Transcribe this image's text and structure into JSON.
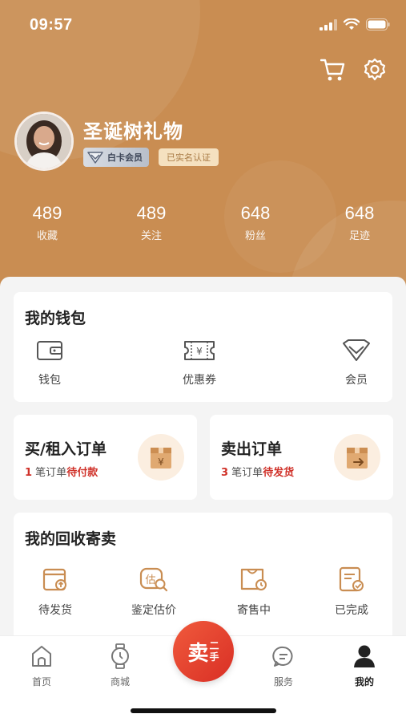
{
  "status_bar": {
    "time": "09:57"
  },
  "profile": {
    "name": "圣诞树礼物",
    "member_badge": "白卡会员",
    "verified_badge": "已实名认证"
  },
  "stats": [
    {
      "value": "489",
      "label": "收藏"
    },
    {
      "value": "489",
      "label": "关注"
    },
    {
      "value": "648",
      "label": "粉丝"
    },
    {
      "value": "648",
      "label": "足迹"
    }
  ],
  "wallet": {
    "title": "我的钱包",
    "items": [
      {
        "label": "钱包",
        "icon": "wallet-icon"
      },
      {
        "label": "优惠券",
        "icon": "coupon-icon"
      },
      {
        "label": "会员",
        "icon": "diamond-icon"
      }
    ]
  },
  "orders": {
    "buy": {
      "title": "买/租入订单",
      "count": "1",
      "text1": " 笔订单",
      "status": "待付款"
    },
    "sell": {
      "title": "卖出订单",
      "count": "3",
      "text1": " 笔订单",
      "status": "待发货"
    }
  },
  "recycle": {
    "title": "我的回收寄卖",
    "items": [
      {
        "label": "待发货",
        "icon": "box-upload-icon"
      },
      {
        "label": "鉴定估价",
        "icon": "appraisal-icon"
      },
      {
        "label": "寄售中",
        "icon": "bag-clock-icon"
      },
      {
        "label": "已完成",
        "icon": "document-check-icon"
      }
    ]
  },
  "tabbar": {
    "items": [
      {
        "label": "首页",
        "icon": "home-icon"
      },
      {
        "label": "商城",
        "icon": "watch-icon"
      },
      {
        "label": "服务",
        "icon": "chat-icon"
      },
      {
        "label": "我的",
        "icon": "user-icon"
      }
    ],
    "sell_main": "卖",
    "sell_sub1": "二",
    "sell_sub2": "手"
  },
  "colors": {
    "header_bg": "#c98d52",
    "accent_red": "#d0322a",
    "icon_orange": "#c98d52"
  }
}
